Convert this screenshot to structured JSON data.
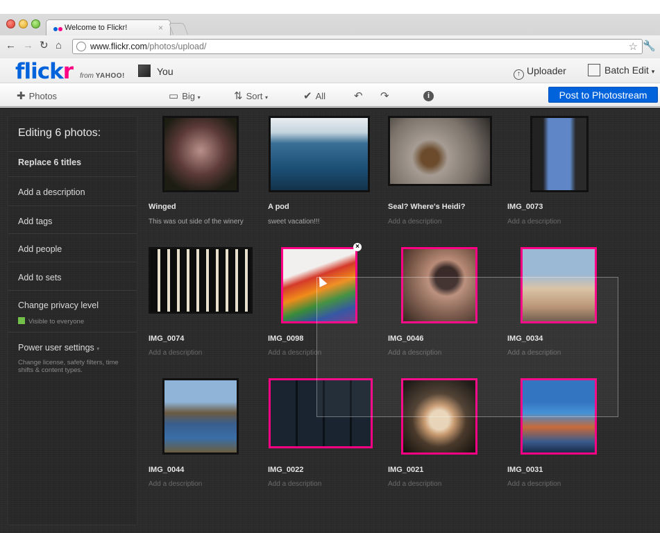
{
  "browser": {
    "tab_title": "Welcome to Flickr!",
    "tab_close": "×",
    "url_host": "www.flickr.com",
    "url_path": "/photos/upload/"
  },
  "header": {
    "logo_main": "flick",
    "logo_accent": "r",
    "from": "from",
    "yahoo": "YAHOO!",
    "you": "You",
    "uploader": "Uploader",
    "batch_edit": "Batch Edit"
  },
  "toolbar": {
    "photos": "Photos",
    "size": "Big",
    "sort": "Sort",
    "all": "All",
    "post": "Post to Photostream"
  },
  "sidebar": {
    "title": "Editing 6 photos:",
    "replace_titles": "Replace 6 titles",
    "add_description": "Add a description",
    "add_tags": "Add tags",
    "add_people": "Add people",
    "add_to_sets": "Add to sets",
    "change_privacy": "Change privacy level",
    "visible": "Visible to everyone",
    "power_user": "Power user settings",
    "power_user_sub": "Change license, safety filters, time shifts & content types."
  },
  "photos": [
    {
      "title": "Winged",
      "desc": "This was out side of the winery",
      "selected": false
    },
    {
      "title": "A pod",
      "desc": "sweet vacation!!!",
      "selected": false
    },
    {
      "title": "Seal? Where's Heidi?",
      "desc": "Add a description",
      "selected": false
    },
    {
      "title": "IMG_0073",
      "desc": "Add a description",
      "selected": false
    },
    {
      "title": "IMG_0074",
      "desc": "Add a description",
      "selected": false
    },
    {
      "title": "IMG_0098",
      "desc": "Add a description",
      "selected": true
    },
    {
      "title": "IMG_0046",
      "desc": "Add a description",
      "selected": true
    },
    {
      "title": "IMG_0034",
      "desc": "Add a description",
      "selected": true
    },
    {
      "title": "IMG_0044",
      "desc": "Add a description",
      "selected": false
    },
    {
      "title": "IMG_0022",
      "desc": "Add a description",
      "selected": true
    },
    {
      "title": "IMG_0021",
      "desc": "Add a description",
      "selected": true
    },
    {
      "title": "IMG_0031",
      "desc": "Add a description",
      "selected": true
    }
  ],
  "colors": {
    "flickr_blue": "#0063dc",
    "flickr_pink": "#ff0084",
    "selection": "#ff0084",
    "background": "#2b2b2b"
  }
}
